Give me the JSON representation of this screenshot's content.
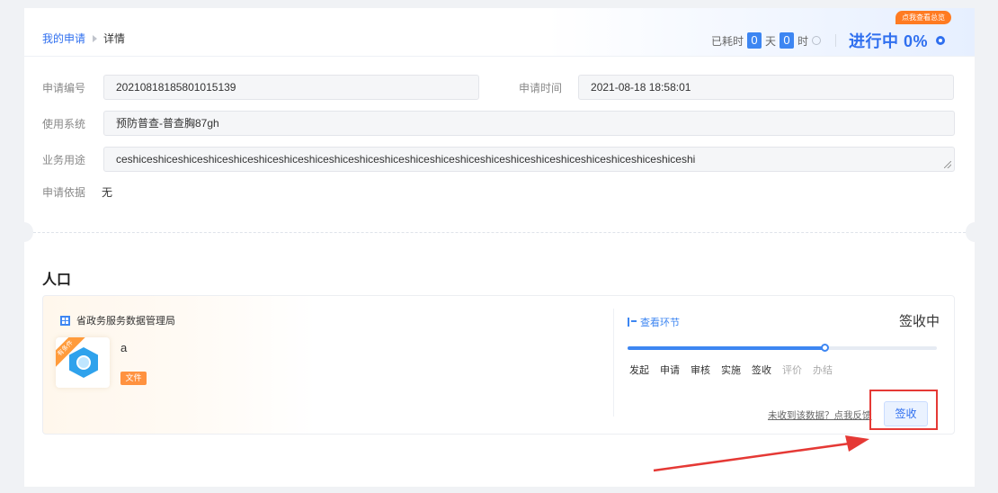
{
  "breadcrumb": {
    "parent": "我的申请",
    "current": "详情"
  },
  "timer": {
    "prefix": "已耗时",
    "days": "0",
    "day_unit": "天",
    "hours": "0",
    "hour_unit": "时"
  },
  "status": {
    "text": "进行中 0%",
    "overview_badge": "点我查看总览"
  },
  "form": {
    "apply_no_label": "申请编号",
    "apply_no": "20210818185801015139",
    "apply_time_label": "申请时间",
    "apply_time": "2021-08-18 18:58:01",
    "system_label": "使用系统",
    "system": "预防普查-普查胸87gh",
    "purpose_label": "业务用途",
    "purpose": "ceshiceshiceshiceshiceshiceshiceshiceshiceshiceshiceshiceshiceshiceshiceshiceshiceshiceshiceshiceshiceshiceshiceshi",
    "basis_label": "申请依据",
    "basis": "无"
  },
  "section": {
    "title": "人口"
  },
  "resource": {
    "org": "省政务服务数据管理局",
    "ribbon": "有条件",
    "name": "a",
    "tag": "文件",
    "view_link": "查看环节",
    "state": "签收中",
    "progress": 0.64,
    "steps": [
      "发起",
      "申请",
      "审核",
      "实施",
      "签收",
      "评价",
      "办结"
    ],
    "current_step_index": 4,
    "feedback": "未收到该数据？点我反馈",
    "sign_button": "签收"
  },
  "colors": {
    "accent": "#2f6fef",
    "highlight": "#e53935",
    "tag": "#ff9240"
  }
}
